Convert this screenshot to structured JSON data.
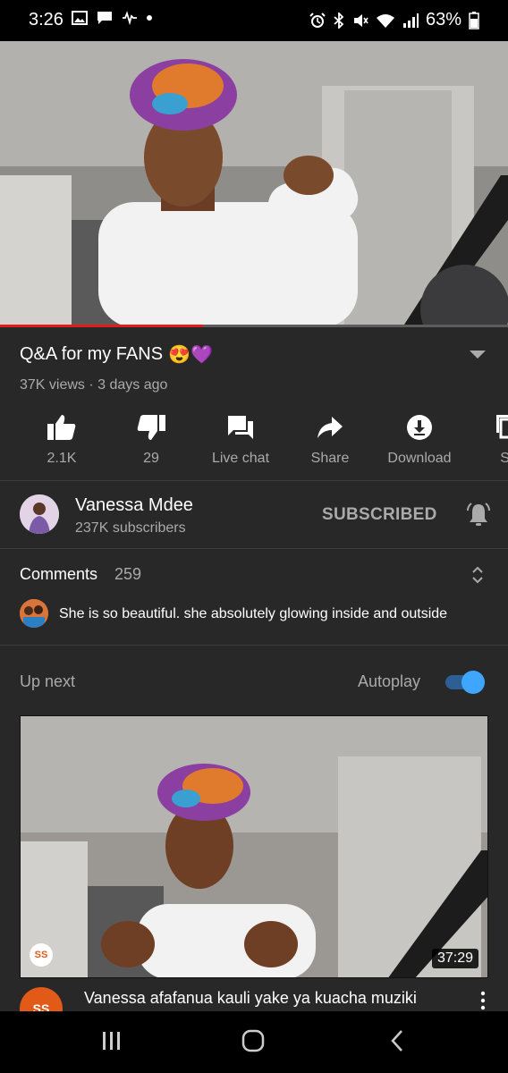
{
  "status_bar": {
    "time": "3:26",
    "battery": "63%"
  },
  "video": {
    "progress": 0.4
  },
  "title": {
    "text": "Q&A for my FANS",
    "emoji": "😍💜"
  },
  "meta": {
    "views": "37K views",
    "separator": " · ",
    "age": "3 days ago"
  },
  "actions": [
    {
      "icon": "thumbs-up-icon",
      "label": "2.1K"
    },
    {
      "icon": "thumbs-down-icon",
      "label": "29"
    },
    {
      "icon": "live-chat-icon",
      "label": "Live chat"
    },
    {
      "icon": "share-icon",
      "label": "Share"
    },
    {
      "icon": "download-icon",
      "label": "Download"
    },
    {
      "icon": "save-icon",
      "label": "Sa"
    }
  ],
  "channel": {
    "name": "Vanessa Mdee",
    "subscribers": "237K subscribers",
    "subscribe_label": "SUBSCRIBED"
  },
  "comments": {
    "heading": "Comments",
    "count": "259",
    "top_comment": "She is so beautiful. she absolutely glowing inside and outside"
  },
  "up_next": {
    "label": "Up next",
    "autoplay_label": "Autoplay",
    "autoplay_on": true
  },
  "next_video": {
    "duration": "37:29",
    "title": "Vanessa afafanua kauli yake ya kuacha muziki",
    "channel_logo": "SS"
  },
  "colors": {
    "background": "#282828",
    "accent_red": "#e21b1b",
    "toggle_blue": "#3ea6ff"
  }
}
